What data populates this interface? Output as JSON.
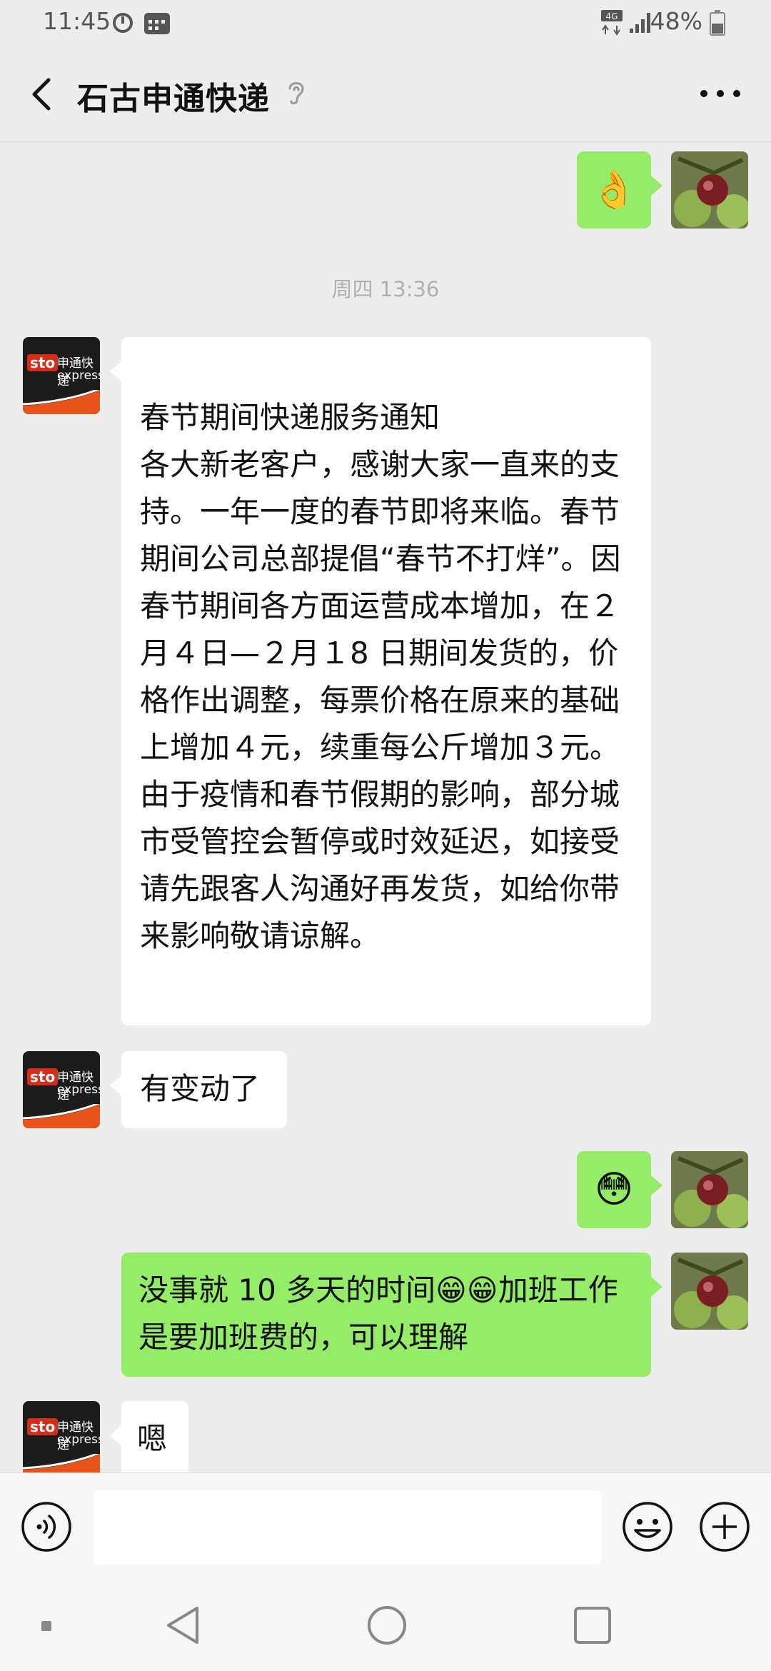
{
  "status_bar": {
    "time": "11:45",
    "network": "4G",
    "battery": "48%"
  },
  "header": {
    "title": "石古申通快递"
  },
  "sto_logo": {
    "badge": "sto",
    "cn": "申通快递",
    "en": "express"
  },
  "timestamp": "周四 13:36",
  "messages": [
    {
      "from": "me",
      "text": "👌"
    },
    {
      "from": "them",
      "paras": [
        "春节期间快递服务通知",
        "各大新老客户，感谢大家一直来的支持。一年一度的春节即将来临。春节期间公司总部提倡“春节不打烊”。因春节期间各方面运营成本增加，在２月４日—２月１8 日期间发货的，价格作出调整，每票价格在原来的基础上增加４元，续重每公斤增加３元。由于疫情和春节假期的影响，部分城市受管控会暂停或时效延迟，如接受请先跟客人沟通好再发货，如给你带来影响敬请谅解。"
      ]
    },
    {
      "from": "them",
      "text": "有变动了"
    },
    {
      "from": "me",
      "text": "😳"
    },
    {
      "from": "me",
      "text": "没事就 10 多天的时间😁😁加班工作是要加班费的，可以理解"
    },
    {
      "from": "them",
      "text": "嗯"
    }
  ],
  "input": {
    "value": "",
    "placeholder": ""
  },
  "icons": {
    "back": "back-arrow-icon",
    "ear": "ear-icon",
    "more": "more-dots-icon",
    "voice": "voice-icon",
    "emoji": "emoji-icon",
    "plus": "plus-icon"
  },
  "colors": {
    "my_bubble": "#95ec69",
    "their_bubble": "#ffffff",
    "background": "#ededed"
  }
}
